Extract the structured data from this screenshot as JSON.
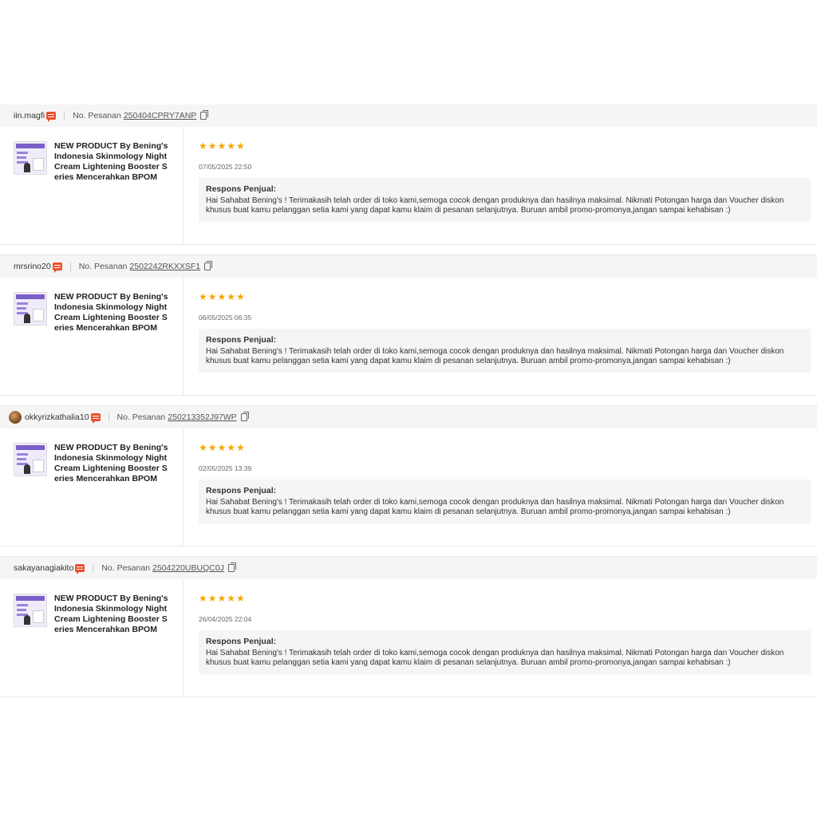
{
  "order_label": "No. Pesanan",
  "reviews": [
    {
      "username": "iin.magfi",
      "has_avatar": false,
      "order_no": "250404CPRY7ANP",
      "product_name": "NEW PRODUCT By Bening's Indonesia Skinmology Night Cream Lightening Booster Series Mencerahkan BPOM",
      "stars": "★★★★★",
      "rating": 5,
      "date": "07/05/2025 22:50",
      "response_title": "Respons Penjual:",
      "response_text": "Hai Sahabat Bening's ! Terimakasih telah order di toko kami,semoga cocok dengan produknya dan hasilnya maksimal. Nikmati Potongan harga dan Voucher diskon khusus buat kamu pelanggan setia kami yang dapat kamu klaim di pesanan selanjutnya. Buruan ambil promo-promonya,jangan sampai kehabisan :)"
    },
    {
      "username": "mrsrino20",
      "has_avatar": false,
      "order_no": "2502242RKXXSF1",
      "product_name": "NEW PRODUCT By Bening's Indonesia Skinmology Night Cream Lightening Booster Series Mencerahkan BPOM",
      "stars": "★★★★★",
      "rating": 5,
      "date": "06/05/2025 06:35",
      "response_title": "Respons Penjual:",
      "response_text": "Hai Sahabat Bening's ! Terimakasih telah order di toko kami,semoga cocok dengan produknya dan hasilnya maksimal. Nikmati Potongan harga dan Voucher diskon khusus buat kamu pelanggan setia kami yang dapat kamu klaim di pesanan selanjutnya. Buruan ambil promo-promonya,jangan sampai kehabisan :)"
    },
    {
      "username": "okkyrizkathalia10",
      "has_avatar": true,
      "order_no": "250213352J97WP",
      "product_name": "NEW PRODUCT By Bening's Indonesia Skinmology Night Cream Lightening Booster Series Mencerahkan BPOM",
      "stars": "★★★★★",
      "rating": 5,
      "date": "02/05/2025 13:39",
      "response_title": "Respons Penjual:",
      "response_text": "Hai Sahabat Bening's ! Terimakasih telah order di toko kami,semoga cocok dengan produknya dan hasilnya maksimal. Nikmati Potongan harga dan Voucher diskon khusus buat kamu pelanggan setia kami yang dapat kamu klaim di pesanan selanjutnya. Buruan ambil promo-promonya,jangan sampai kehabisan :)"
    },
    {
      "username": "sakayanagiakito",
      "has_avatar": false,
      "order_no": "2504220UBUQC0J",
      "product_name": "NEW PRODUCT By Bening's Indonesia Skinmology Night Cream Lightening Booster Series Mencerahkan BPOM",
      "stars": "★★★★★",
      "rating": 5,
      "date": "26/04/2025 22:04",
      "response_title": "Respons Penjual:",
      "response_text": "Hai Sahabat Bening's ! Terimakasih telah order di toko kami,semoga cocok dengan produknya dan hasilnya maksimal. Nikmati Potongan harga dan Voucher diskon khusus buat kamu pelanggan setia kami yang dapat kamu klaim di pesanan selanjutnya. Buruan ambil promo-promonya,jangan sampai kehabisan :)"
    }
  ]
}
